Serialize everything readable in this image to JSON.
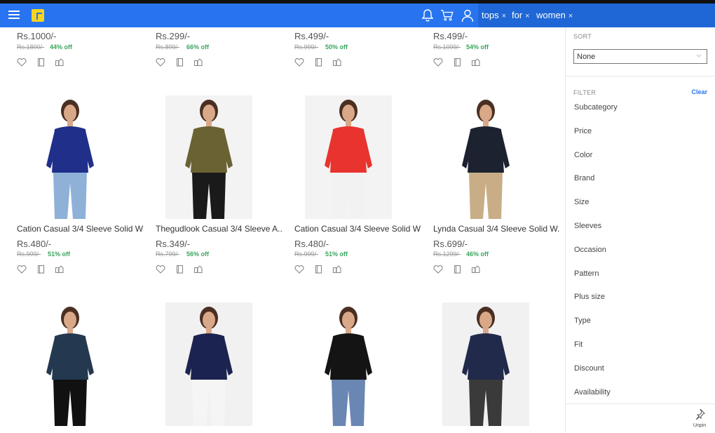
{
  "header": {
    "menu_icon": "hamburger-icon",
    "logo_icon": "flipkart-logo",
    "notification_icon": "bell-icon",
    "cart_icon": "cart-icon",
    "account_icon": "user-icon",
    "search_tags": [
      {
        "label": "tops"
      },
      {
        "label": "for"
      },
      {
        "label": "women"
      }
    ],
    "tag_remove": "×"
  },
  "colors": {
    "brand": "#2874f0",
    "discount": "#3aa55d",
    "logo": "#f7d41e"
  },
  "products_top": [
    {
      "price": "Rs.1000/-",
      "mrp": "Rs.1800/-",
      "off": "44% off"
    },
    {
      "price": "Rs.299/-",
      "mrp": "Rs.899/-",
      "off": "66% off"
    },
    {
      "price": "Rs.499/-",
      "mrp": "Rs.999/-",
      "off": "50% off"
    },
    {
      "price": "Rs.499/-",
      "mrp": "Rs.1099/-",
      "off": "54% off"
    }
  ],
  "products_mid": [
    {
      "title": "Cation Casual 3/4 Sleeve Solid W...",
      "price": "Rs.480/-",
      "mrp": "Rs.999/-",
      "off": "51% off",
      "top_color": "#1f2f8a",
      "bottom_color": "#8fb1d8"
    },
    {
      "title": "Thegudlook Casual 3/4 Sleeve A...",
      "price": "Rs.349/-",
      "mrp": "Rs.799/-",
      "off": "56% off",
      "top_color": "#6b6234",
      "bottom_color": "#1a1a1a"
    },
    {
      "title": "Cation Casual 3/4 Sleeve Solid W...",
      "price": "Rs.480/-",
      "mrp": "Rs.999/-",
      "off": "51% off",
      "top_color": "#e8332e",
      "bottom_color": "#f2f2f2"
    },
    {
      "title": "Lynda Casual 3/4 Sleeve Solid W...",
      "price": "Rs.699/-",
      "mrp": "Rs.1299/-",
      "off": "46% off",
      "top_color": "#1c2230",
      "bottom_color": "#c8ad86"
    }
  ],
  "products_bottom": [
    {
      "top_color": "#24384f",
      "bottom_color": "#111111"
    },
    {
      "top_color": "#1b2350",
      "bottom_color": "#f5f5f5"
    },
    {
      "top_color": "#141414",
      "bottom_color": "#6a86b3"
    },
    {
      "top_color": "#212a4a",
      "bottom_color": "#3a3a3a"
    }
  ],
  "card_actions": [
    "heart-icon",
    "compare-icon",
    "share-icon"
  ],
  "panel": {
    "sort_label": "SORT",
    "sort_value": "None",
    "filter_label": "FILTER",
    "clear_label": "Clear",
    "filters": [
      "Subcategory",
      "Price",
      "Color",
      "Brand",
      "Size",
      "Sleeves",
      "Occasion",
      "Pattern",
      "Plus size",
      "Type",
      "Fit",
      "Discount",
      "Availability"
    ],
    "unpin_label": "Unpin"
  }
}
